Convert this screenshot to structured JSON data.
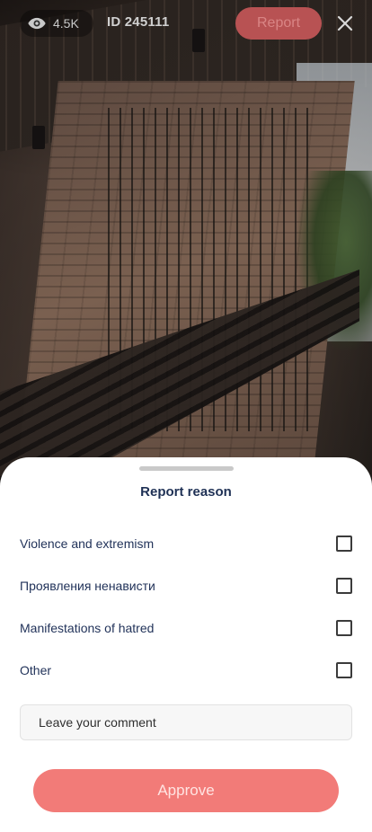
{
  "topbar": {
    "views": "4.5K",
    "id_label": "ID 245111",
    "report_label": "Report",
    "icons": {
      "views": "eye-icon",
      "close": "close-icon"
    }
  },
  "sheet": {
    "title": "Report reason",
    "options": [
      {
        "label": "Violence and extremism",
        "checked": false
      },
      {
        "label": "Проявления ненависти",
        "checked": false
      },
      {
        "label": "Manifestations of hatred",
        "checked": false
      },
      {
        "label": "Other",
        "checked": false
      }
    ],
    "comment": {
      "placeholder": "Leave your comment",
      "value": ""
    },
    "approve_label": "Approve"
  },
  "colors": {
    "accent": "#f27b78",
    "report_button": "#b85253",
    "title_text": "#1f3155"
  }
}
